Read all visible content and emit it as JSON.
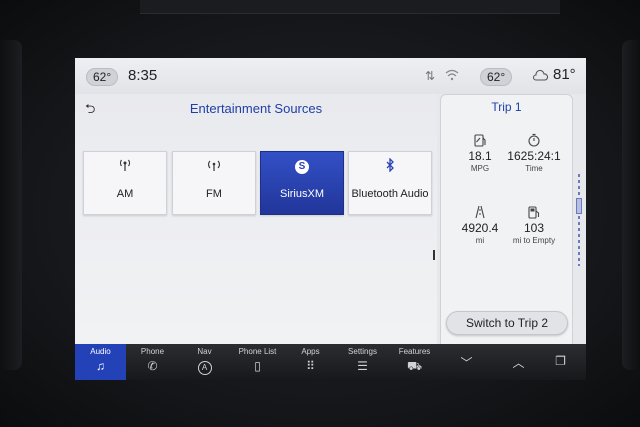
{
  "top_bar": {
    "cabin_temp_left": "62°",
    "time": "8:35",
    "cabin_temp_right": "62°",
    "outside_temp": "81°",
    "icons": [
      "signal-icon",
      "wifi-icon",
      "cloud-sun-icon"
    ]
  },
  "main": {
    "title": "Entertainment Sources",
    "sources": [
      {
        "label": "AM",
        "icon": "radio-tower-icon"
      },
      {
        "label": "FM",
        "icon": "radio-waves-icon"
      },
      {
        "label": "SiriusXM",
        "icon": "siriusxm-logo-icon",
        "active": true
      },
      {
        "label": "Bluetooth Audio",
        "icon": "bluetooth-icon"
      }
    ]
  },
  "trip": {
    "title": "Trip 1",
    "stats": [
      {
        "value": "18.1",
        "unit": "MPG",
        "icon": "fuel-economy-icon"
      },
      {
        "value": "1625:24:1",
        "unit": "Time",
        "icon": "stopwatch-icon"
      },
      {
        "value": "4920.4",
        "unit": "mi",
        "icon": "road-icon"
      },
      {
        "value": "103",
        "unit": "mi to Empty",
        "icon": "fuel-pump-icon"
      }
    ],
    "switch_label": "Switch to Trip 2"
  },
  "nav": [
    {
      "label": "Audio",
      "icon": "music-note-icon",
      "active": true
    },
    {
      "label": "Phone",
      "icon": "phone-icon"
    },
    {
      "label": "Nav",
      "icon": "compass-a-icon"
    },
    {
      "label": "Phone List",
      "icon": "phone-list-icon"
    },
    {
      "label": "Apps",
      "icon": "apps-grid-icon"
    },
    {
      "label": "Settings",
      "icon": "sliders-icon"
    },
    {
      "label": "Features",
      "icon": "car-icon"
    },
    {
      "label": "",
      "icon": "chevron-down-icon"
    },
    {
      "label": "",
      "icon": "chevron-up-icon"
    },
    {
      "label": "",
      "icon": "screens-icon"
    }
  ],
  "colors": {
    "accent": "#2442b8",
    "title_text": "#1f3fa6",
    "screen_bg": "#e7e8ec"
  }
}
